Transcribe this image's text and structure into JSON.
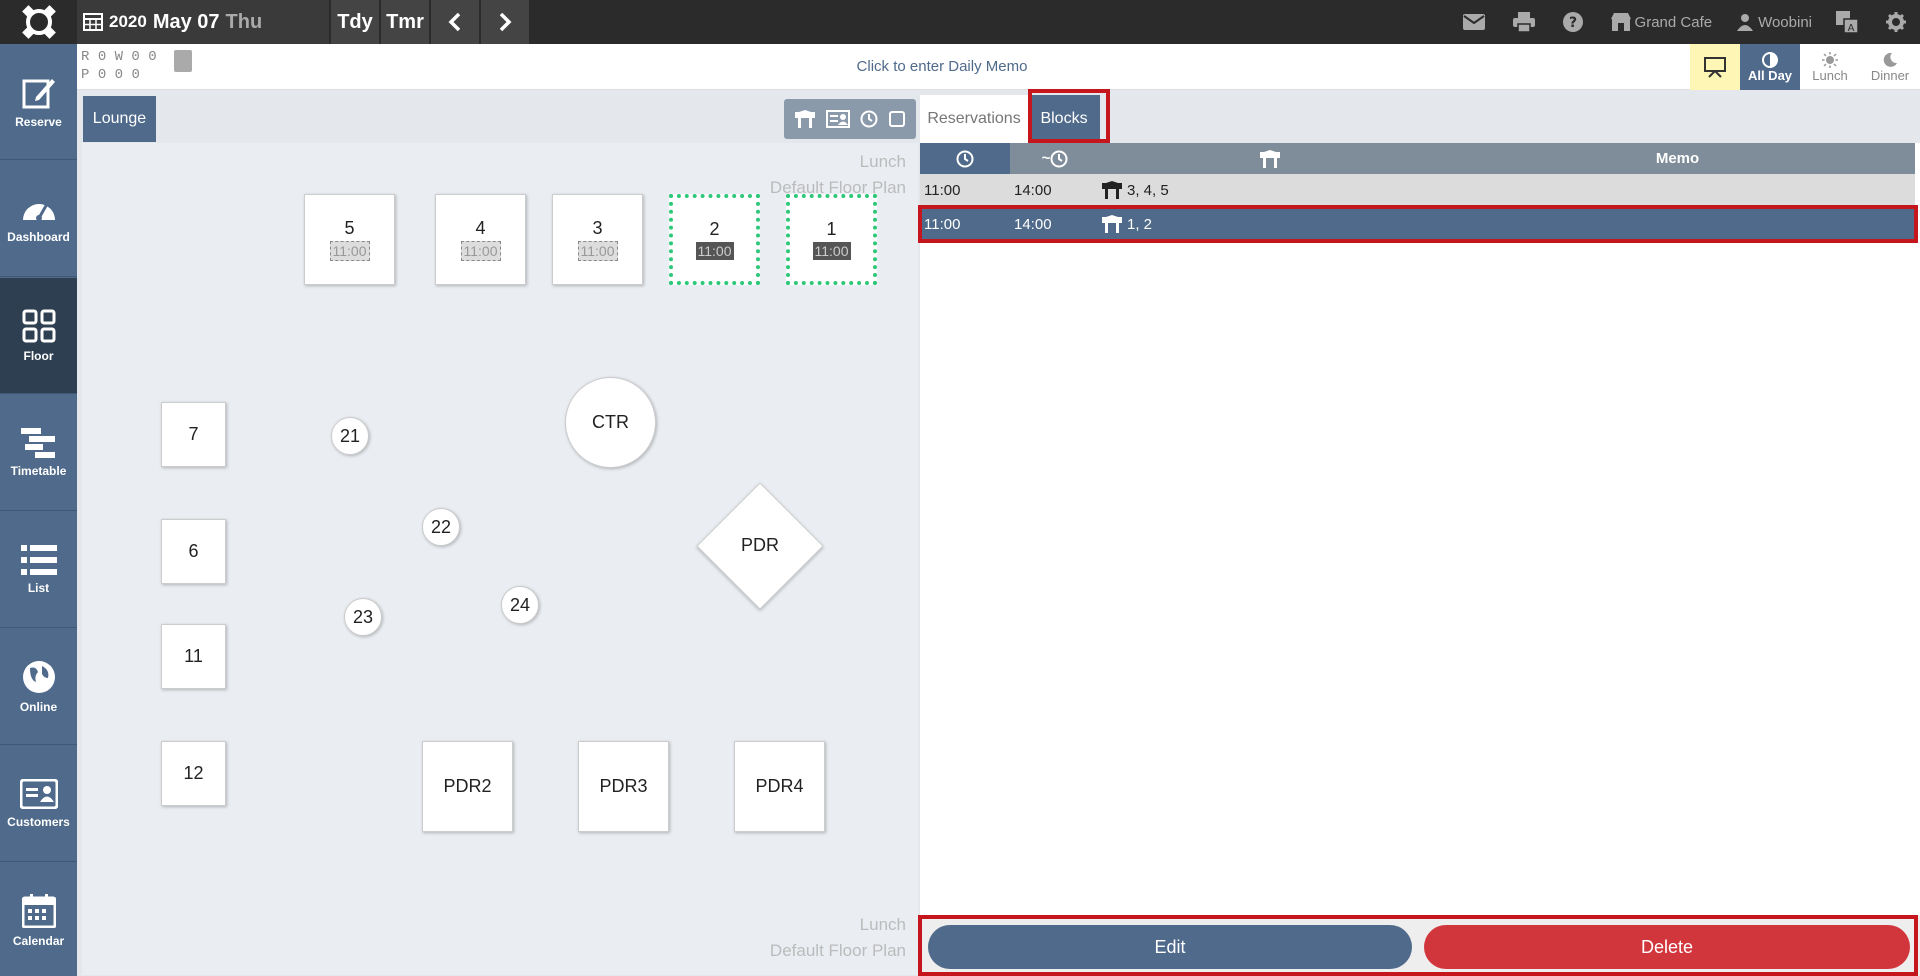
{
  "topbar": {
    "year": "2020",
    "month_day": "May 07",
    "weekday": "Thu",
    "today_label": "Tdy",
    "tomorrow_label": "Tmr",
    "restaurant": "Grand Cafe",
    "user": "Woobini"
  },
  "sidebar": {
    "items": [
      {
        "label": "Reserve",
        "icon": "edit-icon"
      },
      {
        "label": "Dashboard",
        "icon": "gauge-icon"
      },
      {
        "label": "Floor",
        "icon": "floor-grid-icon"
      },
      {
        "label": "Timetable",
        "icon": "timetable-icon"
      },
      {
        "label": "List",
        "icon": "list-icon"
      },
      {
        "label": "Online",
        "icon": "globe-icon"
      },
      {
        "label": "Customers",
        "icon": "id-card-icon"
      },
      {
        "label": "Calendar",
        "icon": "calendar-icon"
      }
    ]
  },
  "stats": {
    "r_label": "R",
    "r_values": "0 W 0",
    "r_extra": "0",
    "p_label": "P",
    "p_values": "0   0",
    "p_extra": "0"
  },
  "memo": {
    "placeholder": "Click to enter Daily Memo"
  },
  "view_modes": {
    "all_day": "All Day",
    "lunch": "Lunch",
    "dinner": "Dinner"
  },
  "floor": {
    "tab": "Lounge",
    "plan_service": "Lunch",
    "plan_name": "Default Floor Plan",
    "tables": {
      "t5": {
        "name": "5",
        "time": "11:00"
      },
      "t4": {
        "name": "4",
        "time": "11:00"
      },
      "t3": {
        "name": "3",
        "time": "11:00"
      },
      "t2": {
        "name": "2",
        "time": "11:00"
      },
      "t1": {
        "name": "1",
        "time": "11:00"
      },
      "t7": "7",
      "t6": "6",
      "t11": "11",
      "t12": "12",
      "t21": "21",
      "t22": "22",
      "t23": "23",
      "t24": "24",
      "ctr": "CTR",
      "pdr": "PDR",
      "pdr2": "PDR2",
      "pdr3": "PDR3",
      "pdr4": "PDR4"
    }
  },
  "panel": {
    "tabs": {
      "reservations": "Reservations",
      "blocks": "Blocks"
    },
    "columns": {
      "end_prefix": "~",
      "memo": "Memo"
    },
    "rows": [
      {
        "start": "11:00",
        "end": "14:00",
        "tables": "3, 4, 5",
        "memo": ""
      },
      {
        "start": "11:00",
        "end": "14:00",
        "tables": "1, 2",
        "memo": ""
      }
    ],
    "edit_label": "Edit",
    "delete_label": "Delete"
  },
  "colors": {
    "primary": "#4f6a8a",
    "danger": "#d2363d",
    "block_dot": "#2ec87a",
    "highlight": "#c4161c"
  }
}
